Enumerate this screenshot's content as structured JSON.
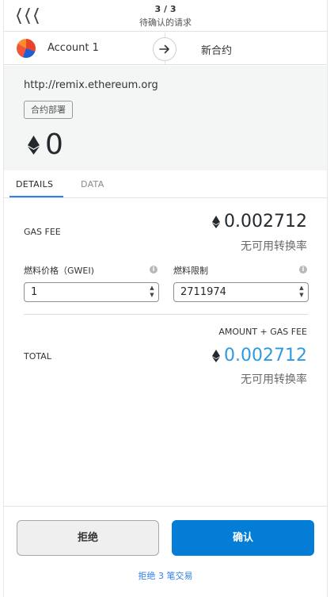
{
  "nav": {
    "counter": "3 / 3",
    "subtitle": "待确认的请求"
  },
  "account": {
    "name": "Account 1",
    "target": "新合约"
  },
  "origin": {
    "url": "http://remix.ethereum.org",
    "badge": "合约部署",
    "amount": "0"
  },
  "tabs": [
    {
      "label": "DETAILS",
      "active": true
    },
    {
      "label": "DATA",
      "active": false
    }
  ],
  "details": {
    "gas_fee_label": "GAS FEE",
    "gas_fee_value": "0.002712",
    "gas_fee_rate": "无可用转换率",
    "gas_price_label": "燃料价格（GWEI)",
    "gas_price_value": "1",
    "gas_limit_label": "燃料限制",
    "gas_limit_value": "2711974",
    "amount_plus_gas_label": "AMOUNT + GAS FEE",
    "total_label": "TOTAL",
    "total_value": "0.002712",
    "total_rate": "无可用转换率"
  },
  "footer": {
    "reject_label": "拒绝",
    "confirm_label": "确认",
    "reject_all_label": "拒绝 3 笔交易"
  },
  "colors": {
    "accent": "#037dd6",
    "total_value": "#2f9ae0",
    "link": "#2f80ed"
  },
  "icons": {
    "nav": "double-chevron-left-icon",
    "arrow": "arrow-right-icon",
    "eth": "ethereum-icon",
    "info": "info-icon"
  }
}
